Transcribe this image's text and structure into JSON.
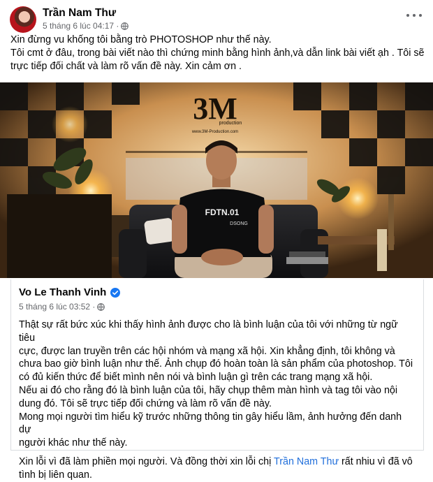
{
  "post": {
    "author": "Trần Nam Thư",
    "timestamp": "5 tháng 6 lúc 04:17 ·",
    "privacy_icon": "globe-icon",
    "text_lines": [
      "Xin đừng vu khống tôi bằng trò PHOTOSHOP như thế này.",
      "Tôi cmt ở đâu, trong bài viết nào thì chứng minh bằng hình ảnh,và dẫn link bài viết ạh . Tôi sẽ",
      "trực tiếp đối chất và làm rõ vấn đề này. Xin cảm ơn ."
    ]
  },
  "photo": {
    "logo_big": "3M",
    "logo_small": "production",
    "logo_url": "www.3M-Production.com",
    "shirt_text": "FDTN.01",
    "shirt_text2": "DSONG"
  },
  "shared": {
    "author": "Vo Le Thanh Vinh",
    "timestamp": "5 tháng 6 lúc 03:52 ·",
    "verified_icon": "verified-badge-icon",
    "paragraph_lines": [
      "Thật sự rất bức xúc khi thấy hình ảnh được cho là bình luận của tôi với những từ ngữ tiêu",
      "cực, được lan truyền trên các hội nhóm và mạng xã hội. Xin khẳng định, tôi không và",
      "chưa bao giờ bình luận như thế. Ảnh chụp đó hoàn toàn là sản phẩm của photoshop. Tôi",
      "có đủ kiến thức để biết mình nên nói và bình luận gì trên các trang mạng xã hội.",
      "Nếu ai đó cho rằng đó là bình luận của tôi, hãy chụp thêm màn hình và tag tôi vào nội",
      "dung đó. Tôi sẽ trực tiếp đối chứng và làm rõ vấn đề này.",
      "Mong mọi người tìm hiểu kỹ trước những thông tin gây hiểu lầm, ảnh hưởng đến danh dự",
      "người khác như thế này."
    ],
    "apology_prefix": "Xin lỗi vì đã làm phiền mọi người. Và đồng thời xin lỗi chị ",
    "apology_mention": "Trần Nam Thư",
    "apology_suffix": " rất nhiu vì đã vô",
    "apology_line2": "tình bị liên quan."
  },
  "colors": {
    "link": "#216fdb",
    "verified": "#1877f2",
    "meta": "#65676b"
  }
}
